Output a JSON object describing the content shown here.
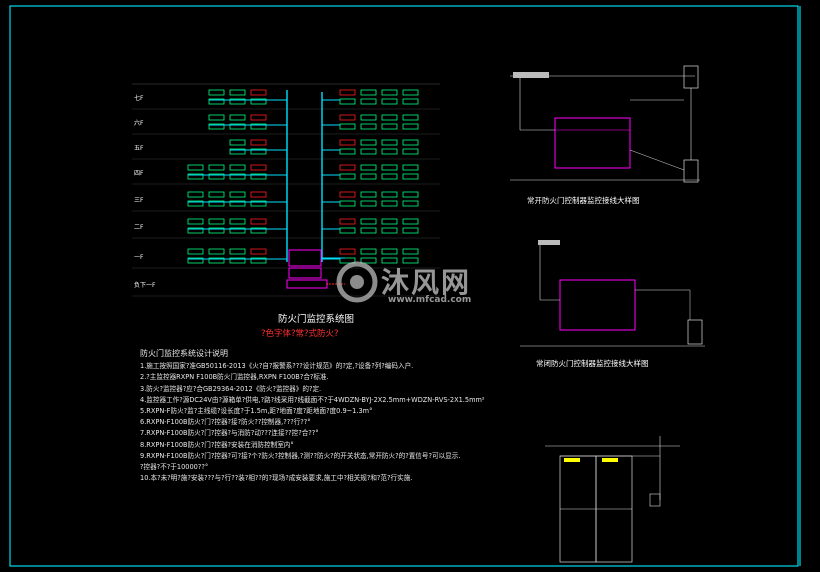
{
  "floors": [
    "七F",
    "六F",
    "五F",
    "四F",
    "三F",
    "二F",
    "一F",
    "负下一F"
  ],
  "diagram": {
    "title": "防火门监控系统图",
    "subtitle": "?色字体?常?式防火?"
  },
  "panels": {
    "normally_open": "常开防火门控制器监控接线大样图",
    "normally_closed": "常闭防火门控制器监控接线大样图"
  },
  "notes": {
    "title": "防火门监控系统设计说明",
    "lines": [
      "1.施工按照国家?准GB50116-2013《火?自?报警系???设计规范》的?定,?设备?列?编码入户.",
      "2.?主监控器RXPN F100B防火门监控器,RXPN F100B?合?标准.",
      "3.防火?监控器?应?合GB29364-2012《防火?监控器》的?定.",
      "4.监控器工作?源DC24V由?源箱单?供电,?路?线采用?线截面不?于4WDZN-BYJ-2X2.5mm+WDZN-RVS-2X1.5mm²",
      "5.RXPN-F防火?监?主线缆?设长度?于1.5m,距?地面?度?距地面?度0.9~1.3m°",
      "6.RXPN-F100B防火?门?控器?接?防火??控制器,???行??°",
      "7.RXPN-F100B防火?门?控器?与消防?动???连接??控?合??°",
      "8.RXPN-F100B防火?门?控器?安装在消防控制室内°",
      "9.RXPN-F100B防火?门?控器?可?接?个?防火?控制器,?测??防火?的开关状态,常开防火?的?置信号?可以显示.",
      "  ?控器?不?于10000??°",
      "10.本?未?明?施?安装???与?行??装?相??的?现场?成安装要求,施工中?相关规?和?范?行实施."
    ]
  },
  "watermark": {
    "brand": "沐风网",
    "url": "www.mfcad.com"
  },
  "colors": {
    "background": "#000000",
    "frame": "#00d8e8",
    "wire_cyan": "#00e0ff",
    "controller_magenta": "#ff00ff",
    "device_red": "#ff2020",
    "device_green": "#00ff80",
    "device_yellow": "#ffff00",
    "text": "#ffffff"
  }
}
